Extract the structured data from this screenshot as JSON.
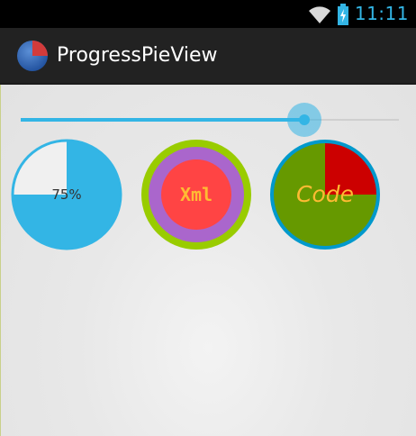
{
  "status_bar": {
    "time": "11:11",
    "icons": [
      "wifi-icon",
      "battery-icon"
    ]
  },
  "action_bar": {
    "title": "ProgressPieView",
    "icon": "pie-app-icon"
  },
  "seekbar": {
    "progress": 0.75,
    "track_color": "#cfcfcf",
    "progress_color": "#33b5e5"
  },
  "pies": [
    {
      "id": "default",
      "label": "75%",
      "progress": 0.75,
      "fill_color": "#33b5e5",
      "background_color": "#f0f0f0",
      "stroke_color": "#33b5e5",
      "text_color": "#333333"
    },
    {
      "id": "xml",
      "label": "Xml",
      "progress": 0.0,
      "fill_color": "#ff4444",
      "background_color": "#aa66cc",
      "stroke_color": "#99cc00",
      "text_color": "#ffbb33"
    },
    {
      "id": "code",
      "label": "Code",
      "progress": 0.25,
      "fill_color": "#cc0000",
      "background_color": "#669900",
      "stroke_color": "#0099cc",
      "text_color": "#ffbb33"
    }
  ]
}
